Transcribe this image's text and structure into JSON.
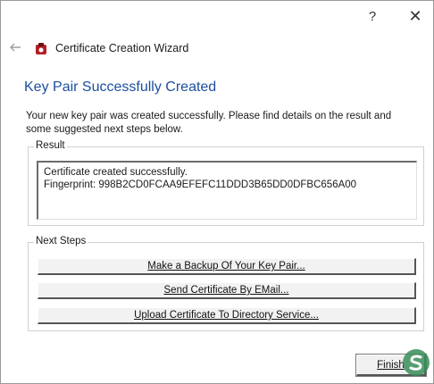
{
  "titlebar": {
    "help_glyph": "?",
    "close_glyph": "✕"
  },
  "wizard": {
    "title": "Certificate Creation Wizard",
    "back_icon": "back-arrow-icon",
    "app_icon": "certificate-app-icon"
  },
  "page": {
    "heading": "Key Pair Successfully Created",
    "description": "Your new key pair was created successfully. Please find details on the result and some suggested next steps below."
  },
  "result": {
    "legend": "Result",
    "line1": "Certificate created successfully.",
    "line2": "Fingerprint: 998B2CD0FCAA9EFEFC11DDD3B65DD0DFBC656A00"
  },
  "next_steps": {
    "legend": "Next Steps",
    "backup_label": "Make a Backup Of Your Key Pair...",
    "send_label": "Send Certificate By EMail...",
    "upload_label": "Upload Certificate To Directory Service..."
  },
  "footer": {
    "finish_label": "Finish"
  },
  "colors": {
    "heading": "#1c4fa0",
    "app_icon": "#b3202a"
  }
}
